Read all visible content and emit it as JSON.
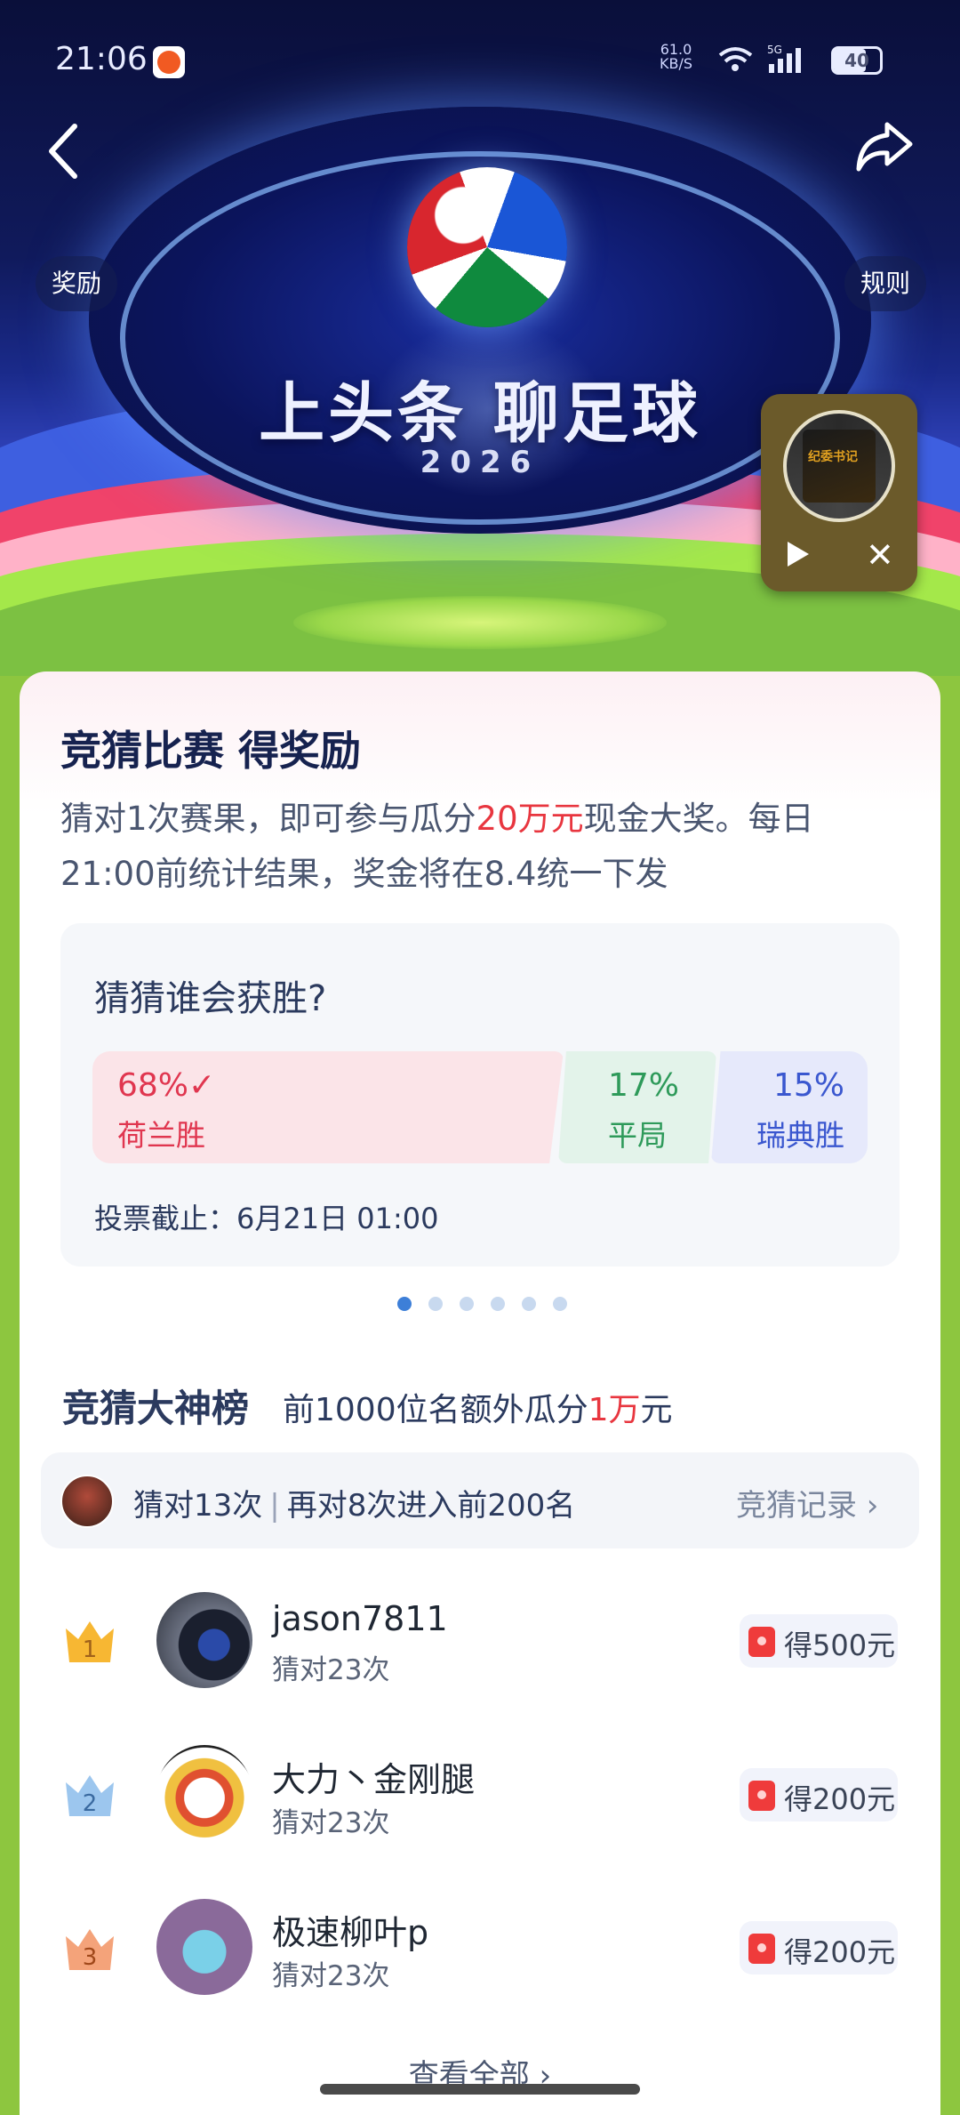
{
  "status_bar": {
    "time": "21:06",
    "net_speed": "61.0\nKB/S",
    "signal": "5G",
    "battery": "40"
  },
  "hero": {
    "title": "上头条 聊足球",
    "year": "2026",
    "left_button": "奖励",
    "right_button": "规则"
  },
  "mini_player": {
    "cover_text": "纪委书记"
  },
  "card": {
    "title": "竞猜比赛 得奖励",
    "desc_part1": "猜对1次赛果，即可参与瓜分",
    "desc_highlight": "20万元",
    "desc_part2": "现金大奖。每日21:00前统计结果，奖金将在8.4统一下发"
  },
  "vote": {
    "question": "猜猜谁会获胜?",
    "options": [
      {
        "pct": "68%✓",
        "label": "荷兰胜",
        "color": "#e0364f"
      },
      {
        "pct": "17%",
        "label": "平局",
        "color": "#2e9a5a"
      },
      {
        "pct": "15%",
        "label": "瑞典胜",
        "color": "#3a57cf"
      }
    ],
    "deadline": "投票截止：6月21日 01:00"
  },
  "pager": {
    "count": 6,
    "active": 0
  },
  "ranking": {
    "title": "竞猜大神榜",
    "subtitle_part1": "前1000位名额外瓜分",
    "subtitle_highlight": "1万",
    "subtitle_part2": "元",
    "my_stats": "猜对13次",
    "my_separator": "|",
    "my_next": "再对8次进入前200名",
    "record_link": "竞猜记录 ›",
    "rows": [
      {
        "rank": "1",
        "name": "jason7811",
        "count": "猜对23次",
        "prize": "得500元",
        "crown_color": "#f7b733"
      },
      {
        "rank": "2",
        "name": "大力丶金刚腿",
        "count": "猜对23次",
        "prize": "得200元",
        "crown_color": "#9cc6ee"
      },
      {
        "rank": "3",
        "name": "极速柳叶p",
        "count": "猜对23次",
        "prize": "得200元",
        "crown_color": "#f4a37a"
      }
    ],
    "more": "查看全部 ›"
  }
}
